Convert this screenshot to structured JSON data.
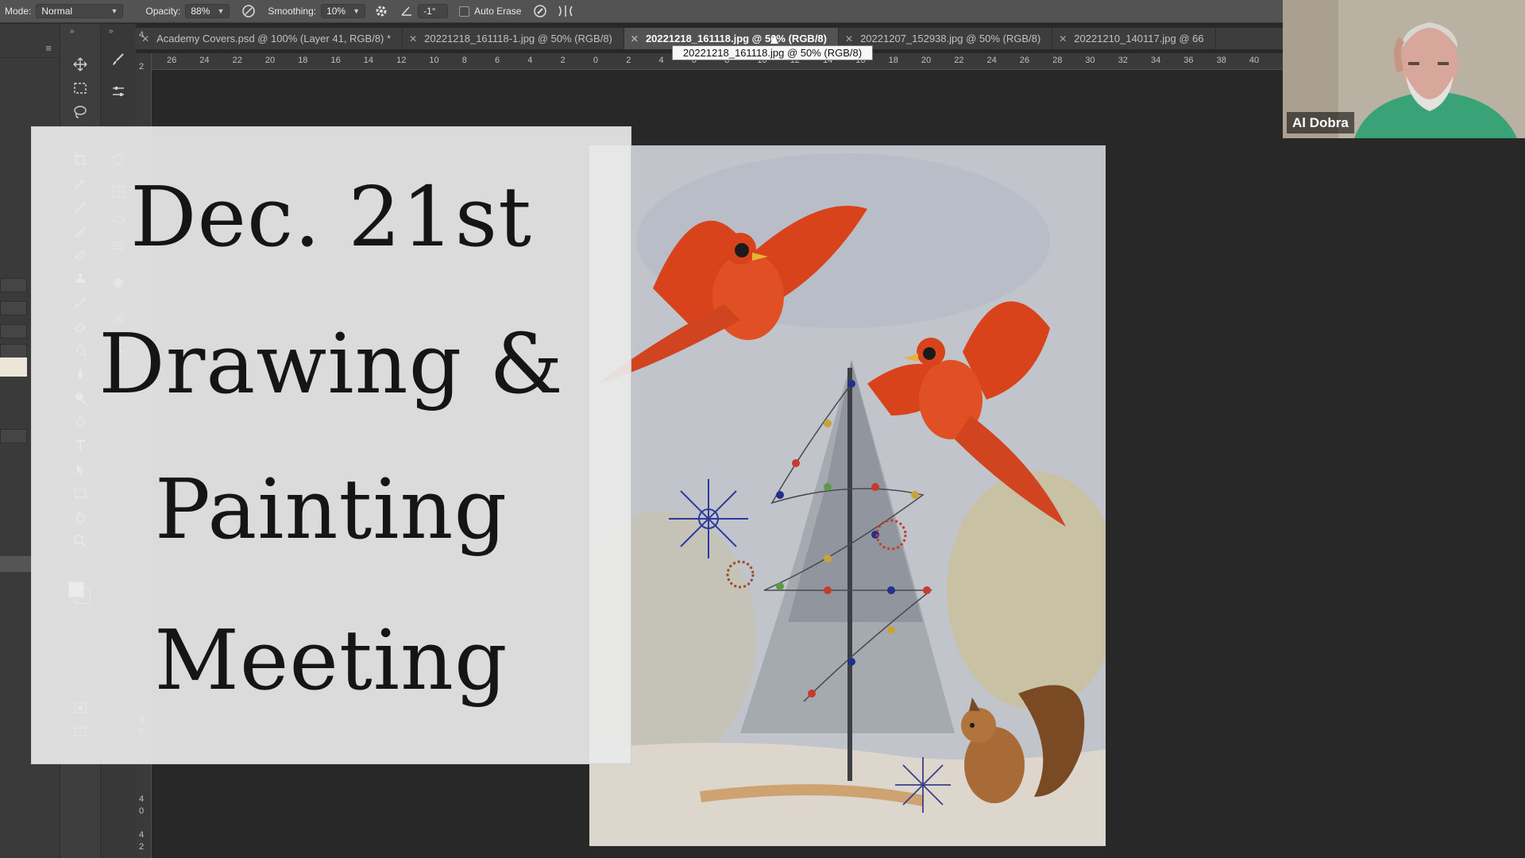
{
  "options_bar": {
    "mode_label": "Mode:",
    "mode_value": "Normal",
    "opacity_label": "Opacity:",
    "opacity_value": "88%",
    "smoothing_label": "Smoothing:",
    "smoothing_value": "10%",
    "angle_value": "-1°",
    "auto_erase_label": "Auto Erase",
    "auto_erase_checked": false
  },
  "tabs": [
    {
      "label": "Academy Covers.psd @ 100% (Layer 41, RGB/8) *"
    },
    {
      "label": "20221218_161118-1.jpg @ 50% (RGB/8)"
    },
    {
      "label": "20221218_161118.jpg @ 50% (RGB/8)"
    },
    {
      "label": "20221207_152938.jpg @ 50% (RGB/8)"
    },
    {
      "label": "20221210_140117.jpg @ 66"
    }
  ],
  "tooltip": "20221218_161118.jpg @ 50% (RGB/8)",
  "ruler": {
    "horizontal": [
      "26",
      "24",
      "22",
      "20",
      "18",
      "16",
      "14",
      "12",
      "10",
      "8",
      "6",
      "4",
      "2",
      "0",
      "2",
      "4",
      "6",
      "8",
      "10",
      "12",
      "14",
      "16",
      "18",
      "20",
      "22",
      "24",
      "26",
      "28",
      "30",
      "32",
      "34",
      "36",
      "38",
      "40"
    ],
    "vertical": [
      "4",
      "2",
      "3",
      "8",
      "4",
      "0",
      "4",
      "2"
    ]
  },
  "title_card": {
    "line1": "Dec. 21st",
    "line2": "Drawing &",
    "line3": "Painting",
    "line4": "Meeting"
  },
  "webcam": {
    "participant_name": "Al Dobra"
  },
  "colors": {
    "panel_bg": "#535353",
    "canvas_bg": "#282828",
    "cardinal_red": "#d8431c"
  },
  "icons": [
    "brush-settings-icon",
    "gear-icon",
    "angle-icon",
    "stylus-pressure-icon",
    "symmetry-icon",
    "move-tool-icon",
    "marquee-tool-icon",
    "lasso-tool-icon",
    "crop-tool-icon",
    "eyedropper-tool-icon",
    "brush-tool-icon",
    "eraser-tool-icon",
    "type-tool-icon",
    "hand-tool-icon",
    "zoom-tool-icon"
  ]
}
